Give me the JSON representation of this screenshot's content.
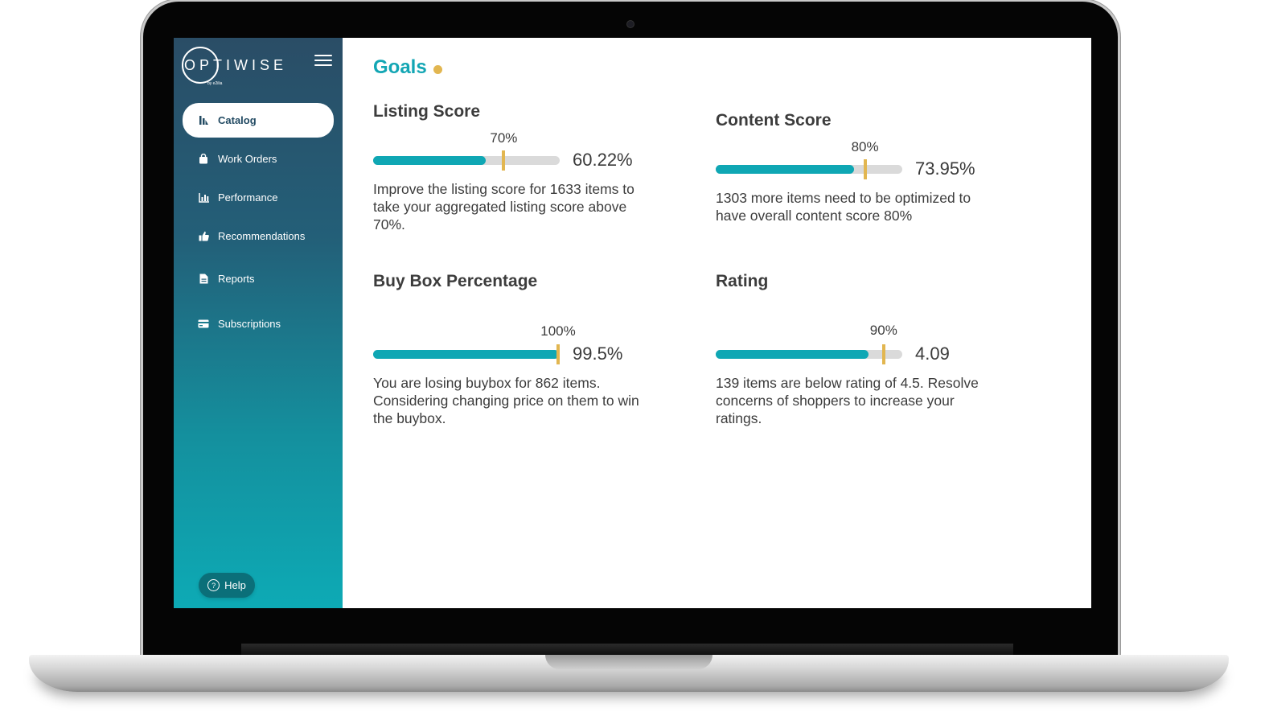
{
  "app": {
    "brand": "OPTIWISE",
    "brand_sub": "by e2ilia"
  },
  "sidebar": {
    "items": [
      {
        "label": "Catalog",
        "icon": "catalog-icon",
        "active": true
      },
      {
        "label": "Work Orders",
        "icon": "bag-icon",
        "active": false
      },
      {
        "label": "Performance",
        "icon": "bar-chart-icon",
        "active": false
      },
      {
        "label": "Recommendations",
        "icon": "thumbs-up-icon",
        "active": false
      },
      {
        "label": "Reports",
        "icon": "document-icon",
        "active": false
      },
      {
        "label": "Subscriptions",
        "icon": "credit-card-icon",
        "active": false
      }
    ],
    "help_label": "Help"
  },
  "main": {
    "title": "Goals",
    "cards": [
      {
        "title": "Listing Score",
        "target_label": "70%",
        "target": 0.7,
        "value_label": "60.22%",
        "value": 0.6022,
        "description": "Improve the listing score for 1633 items to take your aggregated listing score above 70%."
      },
      {
        "title": "Content Score",
        "target_label": "80%",
        "target": 0.8,
        "value_label": "73.95%",
        "value": 0.7395,
        "description": "1303 more items need to be optimized to have overall content score 80%"
      },
      {
        "title": "Buy Box Percentage",
        "target_label": "100%",
        "target": 1.0,
        "value_label": "99.5%",
        "value": 0.995,
        "description": "You are losing buybox for 862 items. Considering changing price on them to win the buybox."
      },
      {
        "title": "Rating",
        "target_label": "90%",
        "target": 0.9,
        "value_label": "4.09",
        "value": 0.818,
        "description": "139 items are below rating of 4.5. Resolve concerns of shoppers to increase your ratings."
      }
    ]
  },
  "colors": {
    "accent": "#13a6b4",
    "marker": "#e2b650",
    "sidebar_top": "#2a4d66",
    "sidebar_bottom": "#0daab5"
  }
}
